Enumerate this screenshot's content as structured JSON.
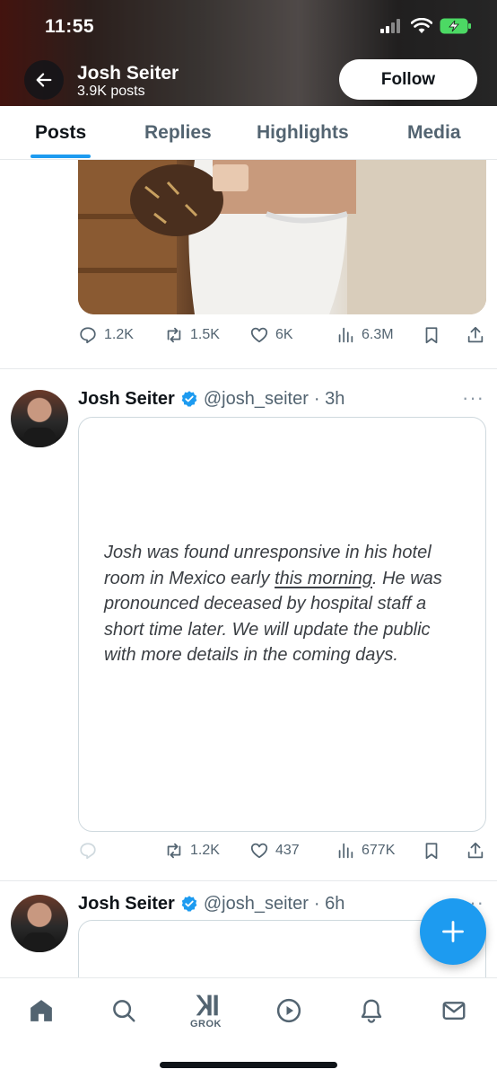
{
  "status_bar": {
    "time": "11:55"
  },
  "profile_header": {
    "name": "Josh Seiter",
    "posts_count": "3.9K posts",
    "follow_label": "Follow"
  },
  "tabs": [
    {
      "label": "Posts",
      "active": true
    },
    {
      "label": "Replies",
      "active": false
    },
    {
      "label": "Highlights",
      "active": false
    },
    {
      "label": "Media",
      "active": false
    }
  ],
  "posts": [
    {
      "stats": {
        "replies": "1.2K",
        "reposts": "1.5K",
        "likes": "6K",
        "views": "6.3M"
      }
    },
    {
      "author": "Josh Seiter",
      "handle": "@josh_seiter",
      "time": "· 3h",
      "text_before_link": "Josh was found unresponsive in his hotel room in Mexico early ",
      "text_link": "this morning",
      "text_after_link": ". He was pronounced deceased by hospital staff a short time later. We will update the public with more details in the coming days.",
      "stats": {
        "replies": "",
        "reposts": "1.2K",
        "likes": "437",
        "views": "677K"
      }
    },
    {
      "author": "Josh Seiter",
      "handle": "@josh_seiter",
      "time": "· 6h"
    }
  ],
  "bottom_nav": {
    "grok_label": "GROK"
  },
  "colors": {
    "accent": "#1d9bf0",
    "text": "#0f1419",
    "secondary": "#536471"
  }
}
